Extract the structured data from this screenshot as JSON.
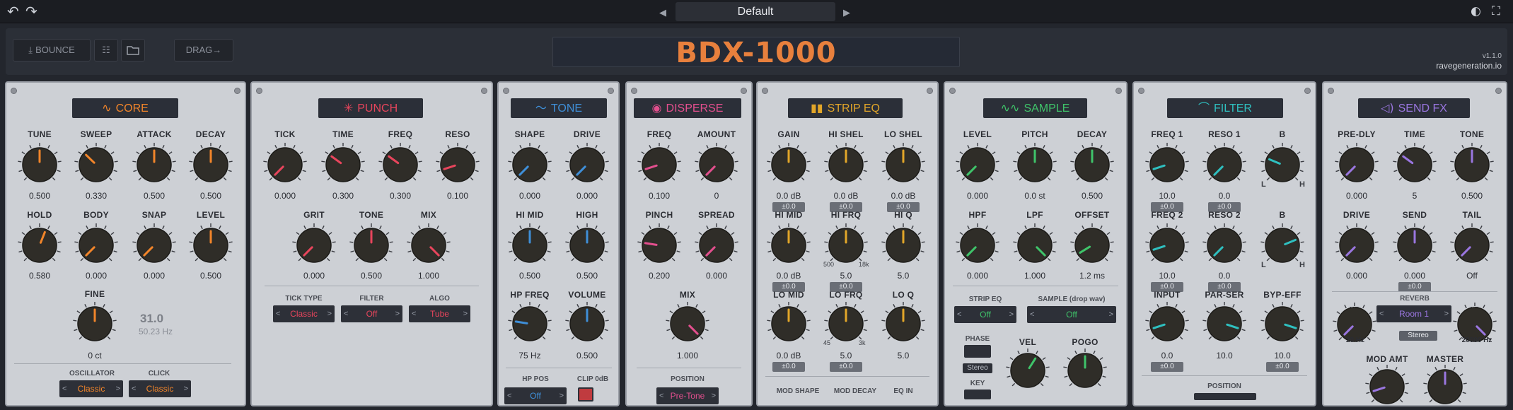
{
  "header": {
    "undo_icon": "undo-icon",
    "redo_icon": "redo-icon",
    "preset": "Default",
    "prev_icon": "triangle-left-icon",
    "next_icon": "triangle-right-icon"
  },
  "toolbar": {
    "bounce": "BOUNCE",
    "drag": "DRAG→",
    "logo": "BDX-1000",
    "version": "v1.1.0",
    "site": "ravegeneration.io"
  },
  "colors": {
    "core": "#f2852a",
    "punch": "#e8455c",
    "tone": "#3f8fd8",
    "disperse": "#e34f8e",
    "strip_eq": "#e2a629",
    "sample": "#3fc46a",
    "filter": "#2fc0c0",
    "send_fx": "#9a76e0",
    "logo": "#e8803d"
  },
  "panels": {
    "core": {
      "title": "CORE",
      "knobs": [
        {
          "label": "TUNE",
          "value": "0.500",
          "level": 0.5
        },
        {
          "label": "SWEEP",
          "value": "0.330",
          "level": 0.33
        },
        {
          "label": "ATTACK",
          "value": "0.500",
          "level": 0.5
        },
        {
          "label": "DECAY",
          "value": "0.500",
          "level": 0.5
        },
        {
          "label": "HOLD",
          "value": "0.580",
          "level": 0.58
        },
        {
          "label": "BODY",
          "value": "0.000",
          "level": 0
        },
        {
          "label": "SNAP",
          "value": "0.000",
          "level": 0
        },
        {
          "label": "LEVEL",
          "value": "0.500",
          "level": 0.5
        },
        {
          "label": "FINE",
          "value": "0 ct",
          "level": 0.5
        }
      ],
      "fine_big": "31.0",
      "fine_hz": "50.23 Hz",
      "selects": [
        {
          "label": "OSCILLATOR",
          "value": "Classic"
        },
        {
          "label": "CLICK",
          "value": "Classic"
        }
      ]
    },
    "punch": {
      "title": "PUNCH",
      "knobs": [
        {
          "label": "TICK",
          "value": "0.000",
          "level": 0
        },
        {
          "label": "TIME",
          "value": "0.300",
          "level": 0.3
        },
        {
          "label": "FREQ",
          "value": "0.300",
          "level": 0.3
        },
        {
          "label": "RESO",
          "value": "0.100",
          "level": 0.1
        },
        {
          "label": "GRIT",
          "value": "0.000",
          "level": 0
        },
        {
          "label": "TONE",
          "value": "0.500",
          "level": 0.5
        },
        {
          "label": "MIX",
          "value": "1.000",
          "level": 1
        }
      ],
      "selects": [
        {
          "label": "TICK TYPE",
          "value": "Classic"
        },
        {
          "label": "FILTER",
          "value": "Off"
        },
        {
          "label": "ALGO",
          "value": "Tube"
        }
      ]
    },
    "tone": {
      "title": "TONE",
      "knobs": [
        {
          "label": "SHAPE",
          "value": "0.000",
          "level": 0
        },
        {
          "label": "DRIVE",
          "value": "0.000",
          "level": 0
        },
        {
          "label": "HI MID",
          "value": "0.500",
          "level": 0.5
        },
        {
          "label": "HIGH",
          "value": "0.500",
          "level": 0.5
        },
        {
          "label": "HP FREQ",
          "value": "75 Hz",
          "level": 0.2
        },
        {
          "label": "VOLUME",
          "value": "0.500",
          "level": 0.5
        }
      ],
      "selects": [
        {
          "label": "HP POS",
          "value": "Off"
        },
        {
          "label": "CLIP 0dB",
          "value": ""
        }
      ]
    },
    "disperse": {
      "title": "DISPERSE",
      "knobs": [
        {
          "label": "FREQ",
          "value": "0.100",
          "level": 0.1
        },
        {
          "label": "AMOUNT",
          "value": "0",
          "level": 0
        },
        {
          "label": "PINCH",
          "value": "0.200",
          "level": 0.2
        },
        {
          "label": "SPREAD",
          "value": "0.000",
          "level": 0
        },
        {
          "label": "MIX",
          "value": "1.000",
          "level": 1
        }
      ],
      "selects": [
        {
          "label": "POSITION",
          "value": "Pre-Tone"
        }
      ]
    },
    "strip_eq": {
      "title": "STRIP EQ",
      "knobs": [
        {
          "label": "GAIN",
          "value": "0.0 dB",
          "level": 0.5,
          "badge": "±0.0"
        },
        {
          "label": "HI SHEL",
          "value": "0.0 dB",
          "level": 0.5,
          "badge": "±0.0"
        },
        {
          "label": "LO SHEL",
          "value": "0.0 dB",
          "level": 0.5,
          "badge": "±0.0"
        },
        {
          "label": "HI MID",
          "value": "0.0 dB",
          "level": 0.5,
          "badge": "±0.0"
        },
        {
          "label": "HI FRQ",
          "value": "5.0",
          "level": 0.5,
          "badge": "±0.0",
          "min": "500",
          "max": "18k"
        },
        {
          "label": "HI Q",
          "value": "5.0",
          "level": 0.5
        },
        {
          "label": "LO MID",
          "value": "0.0 dB",
          "level": 0.5,
          "badge": "±0.0"
        },
        {
          "label": "LO FRQ",
          "value": "5.0",
          "level": 0.5,
          "badge": "±0.0",
          "min": "45",
          "max": "3k"
        },
        {
          "label": "LO Q",
          "value": "5.0",
          "level": 0.5
        }
      ],
      "bottom": [
        "MOD SHAPE",
        "MOD DECAY",
        "EQ IN"
      ]
    },
    "sample": {
      "title": "SAMPLE",
      "knobs": [
        {
          "label": "LEVEL",
          "value": "0.000",
          "level": 0
        },
        {
          "label": "PITCH",
          "value": "0.0 st",
          "level": 0.5
        },
        {
          "label": "DECAY",
          "value": "0.500",
          "level": 0.5
        },
        {
          "label": "HPF",
          "value": "0.000",
          "level": 0
        },
        {
          "label": "LPF",
          "value": "1.000",
          "level": 1
        },
        {
          "label": "OFFSET",
          "value": "1.2 ms",
          "level": 0.05
        },
        {
          "label": "VEL",
          "value": "",
          "level": 0.62
        },
        {
          "label": "POGO",
          "value": "",
          "level": 0.5
        }
      ],
      "selects": [
        {
          "label": "STRIP EQ",
          "value": "Off"
        },
        {
          "label": "SAMPLE  (drop wav)",
          "value": "Off"
        }
      ],
      "phase": "PHASE",
      "stereo": "Stereo",
      "key": "KEY"
    },
    "filter": {
      "title": "FILTER",
      "knobs": [
        {
          "label": "FREQ 1",
          "value": "10.0",
          "level": 0.1,
          "badge": "±0.0"
        },
        {
          "label": "RESO 1",
          "value": "0.0",
          "level": 0,
          "badge": "±0.0"
        },
        {
          "label": "B",
          "value": "",
          "level": 0.25,
          "lo": "L",
          "hi": "H"
        },
        {
          "label": "FREQ 2",
          "value": "10.0",
          "level": 0.1,
          "badge": "±0.0"
        },
        {
          "label": "RESO 2",
          "value": "0.0",
          "level": 0,
          "badge": "±0.0"
        },
        {
          "label": "B",
          "value": "",
          "level": 0.75,
          "lo": "L",
          "hi": "H"
        },
        {
          "label": "INPUT",
          "value": "0.0",
          "level": 0.1,
          "badge": "±0.0"
        },
        {
          "label": "PAR-SER",
          "value": "10.0",
          "level": 0.9
        },
        {
          "label": "BYP-EFF",
          "value": "10.0",
          "level": 0.9,
          "badge": "±0.0"
        }
      ],
      "position": "POSITION"
    },
    "send_fx": {
      "title": "SEND FX",
      "knobs": [
        {
          "label": "PRE-DLY",
          "value": "0.000",
          "level": 0
        },
        {
          "label": "TIME",
          "value": "5",
          "level": 0.3
        },
        {
          "label": "TONE",
          "value": "0.500",
          "level": 0.5
        },
        {
          "label": "DRIVE",
          "value": "0.000",
          "level": 0
        },
        {
          "label": "SEND",
          "value": "0.000",
          "level": 0.5,
          "badge": "±0.0"
        },
        {
          "label": "TAIL",
          "value": "Off",
          "level": 0
        }
      ],
      "reverb": "REVERB",
      "room": "Room 1",
      "stereo": "Stereo",
      "hp": "HP",
      "hp_val": "20 Hz",
      "lp": "LP",
      "lp_val": "20000 Hz",
      "bottom": [
        "MOD AMT",
        "MASTER"
      ]
    }
  }
}
